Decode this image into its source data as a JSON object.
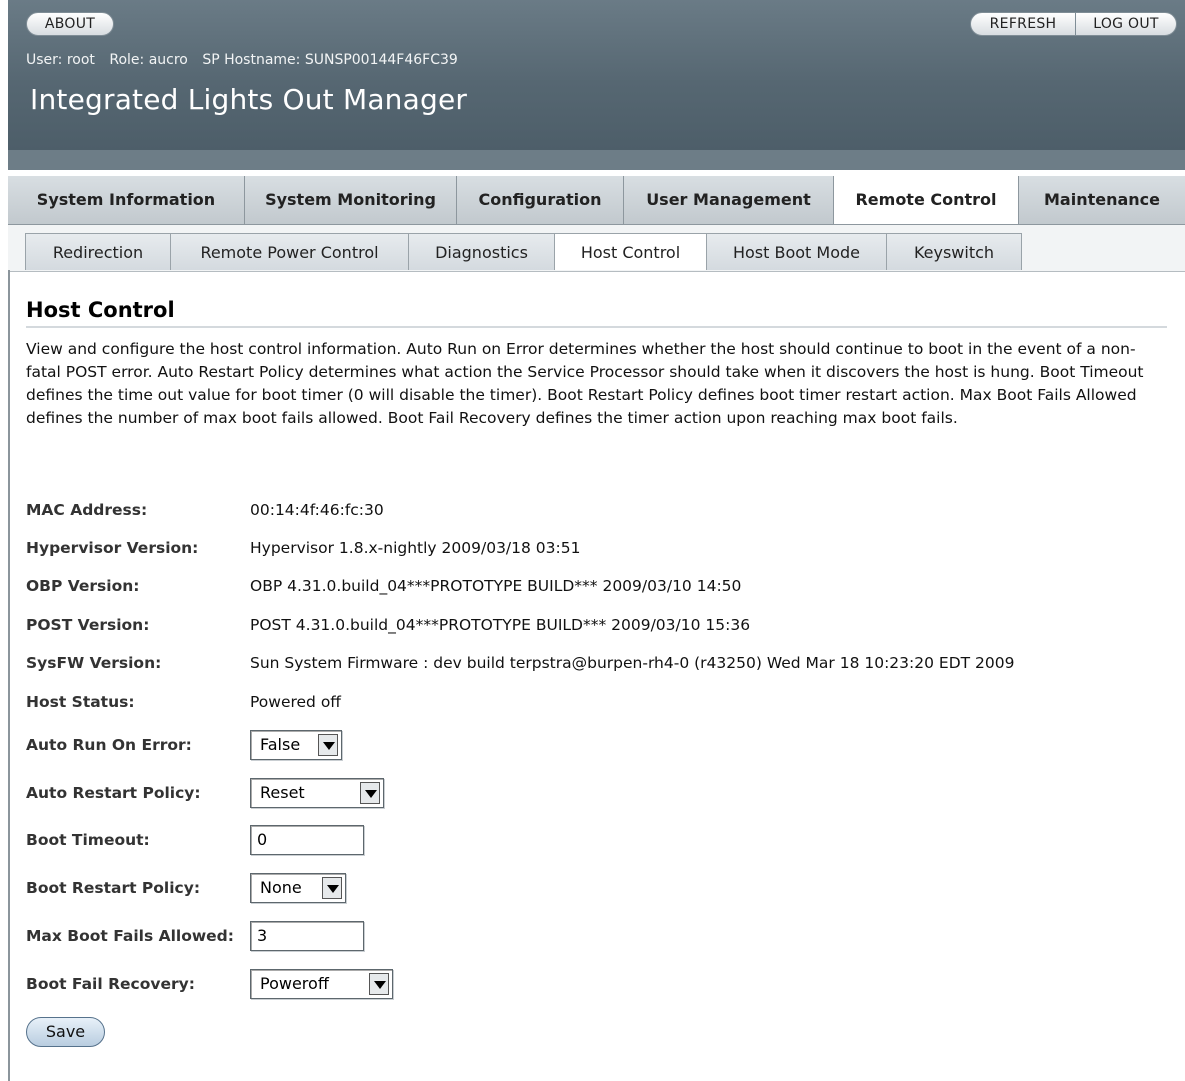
{
  "header": {
    "about_label": "ABOUT",
    "refresh_label": "REFRESH",
    "logout_label": "LOG OUT",
    "user": "User:  root",
    "role": "Role:  aucro",
    "hostname": "SP Hostname:  SUNSP00144F46FC39",
    "app_title": "Integrated Lights Out Manager"
  },
  "tabs": [
    {
      "label": "System Information",
      "active": false
    },
    {
      "label": "System Monitoring",
      "active": false
    },
    {
      "label": "Configuration",
      "active": false
    },
    {
      "label": "User Management",
      "active": false
    },
    {
      "label": "Remote Control",
      "active": true
    },
    {
      "label": "Maintenance",
      "active": false
    }
  ],
  "subtabs": [
    {
      "label": "Redirection",
      "active": false
    },
    {
      "label": "Remote Power Control",
      "active": false
    },
    {
      "label": "Diagnostics",
      "active": false
    },
    {
      "label": "Host Control",
      "active": true
    },
    {
      "label": "Host Boot Mode",
      "active": false
    },
    {
      "label": "Keyswitch",
      "active": false
    }
  ],
  "page": {
    "title": "Host Control",
    "description": "View and configure the host control information. Auto Run on Error determines whether the host should continue to boot in the event of a non-fatal POST error. Auto Restart Policy determines what action the Service Processor should take when it discovers the host is hung. Boot Timeout defines the time out value for boot timer (0 will disable the timer). Boot Restart Policy defines boot timer restart action. Max Boot Fails Allowed defines the number of max boot fails allowed. Boot Fail Recovery defines the timer action upon reaching max boot fails."
  },
  "info": [
    {
      "label": "MAC Address:",
      "value": "00:14:4f:46:fc:30"
    },
    {
      "label": "Hypervisor Version:",
      "value": "Hypervisor 1.8.x-nightly 2009/03/18 03:51"
    },
    {
      "label": "OBP Version:",
      "value": "OBP 4.31.0.build_04***PROTOTYPE BUILD*** 2009/03/10 14:50"
    },
    {
      "label": "POST Version:",
      "value": "POST 4.31.0.build_04***PROTOTYPE BUILD*** 2009/03/10 15:36"
    },
    {
      "label": "SysFW Version:",
      "value": "Sun System Firmware : dev build terpstra@burpen-rh4-0 (r43250) Wed Mar 18 10:23:20 EDT 2009"
    },
    {
      "label": "Host Status:",
      "value": "Powered off"
    }
  ],
  "settings": {
    "auto_run_on_error": {
      "label": "Auto Run On Error:",
      "value": "False"
    },
    "auto_restart_policy": {
      "label": "Auto Restart Policy:",
      "value": "Reset"
    },
    "boot_timeout": {
      "label": "Boot Timeout:",
      "value": "0"
    },
    "boot_restart_policy": {
      "label": "Boot Restart Policy:",
      "value": "None"
    },
    "max_boot_fails": {
      "label": "Max Boot Fails Allowed:",
      "value": "3"
    },
    "boot_fail_recovery": {
      "label": "Boot Fail Recovery:",
      "value": "Poweroff"
    }
  },
  "save_label": "Save"
}
